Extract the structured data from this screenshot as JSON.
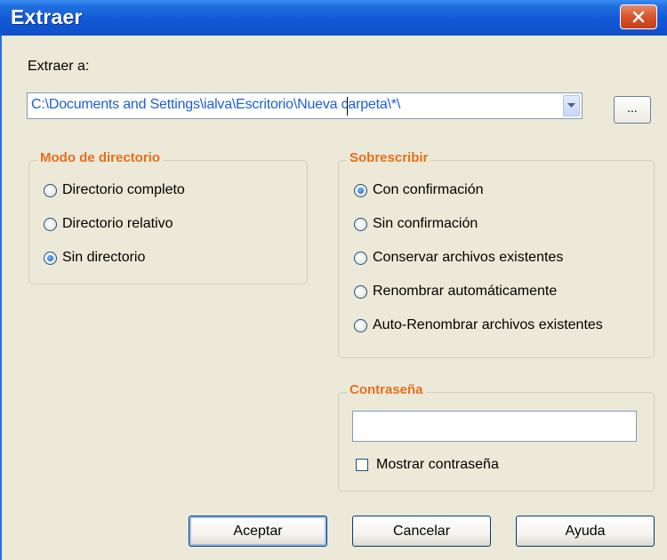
{
  "window": {
    "title": "Extraer"
  },
  "extract_to": {
    "label": "Extraer a:",
    "path_value": "C:\\Documents and Settings\\ialva\\Escritorio\\Nueva carpeta\\*\\",
    "browse_label": "..."
  },
  "directory_mode": {
    "title": "Modo de directorio",
    "options": [
      {
        "label": "Directorio completo",
        "checked": false
      },
      {
        "label": "Directorio relativo",
        "checked": false
      },
      {
        "label": "Sin directorio",
        "checked": true
      }
    ]
  },
  "overwrite": {
    "title": "Sobrescribir",
    "options": [
      {
        "label": "Con confirmación",
        "checked": true
      },
      {
        "label": "Sin confirmación",
        "checked": false
      },
      {
        "label": "Conservar archivos existentes",
        "checked": false
      },
      {
        "label": "Renombrar automáticamente",
        "checked": false
      },
      {
        "label": "Auto-Renombrar archivos existentes",
        "checked": false
      }
    ]
  },
  "password": {
    "title": "Contraseña",
    "value": "",
    "show_label": "Mostrar contraseña",
    "show_checked": false
  },
  "buttons": {
    "accept": "Aceptar",
    "cancel": "Cancelar",
    "help": "Ayuda"
  },
  "icons": {
    "close": "close-icon",
    "dropdown": "chevron-down-icon"
  },
  "colors": {
    "titlebar": "#1258d6",
    "group_title": "#e56f1b",
    "dialog_bg": "#ece9d8",
    "close_button": "#d9572f",
    "path_text": "#1d5fd6"
  }
}
